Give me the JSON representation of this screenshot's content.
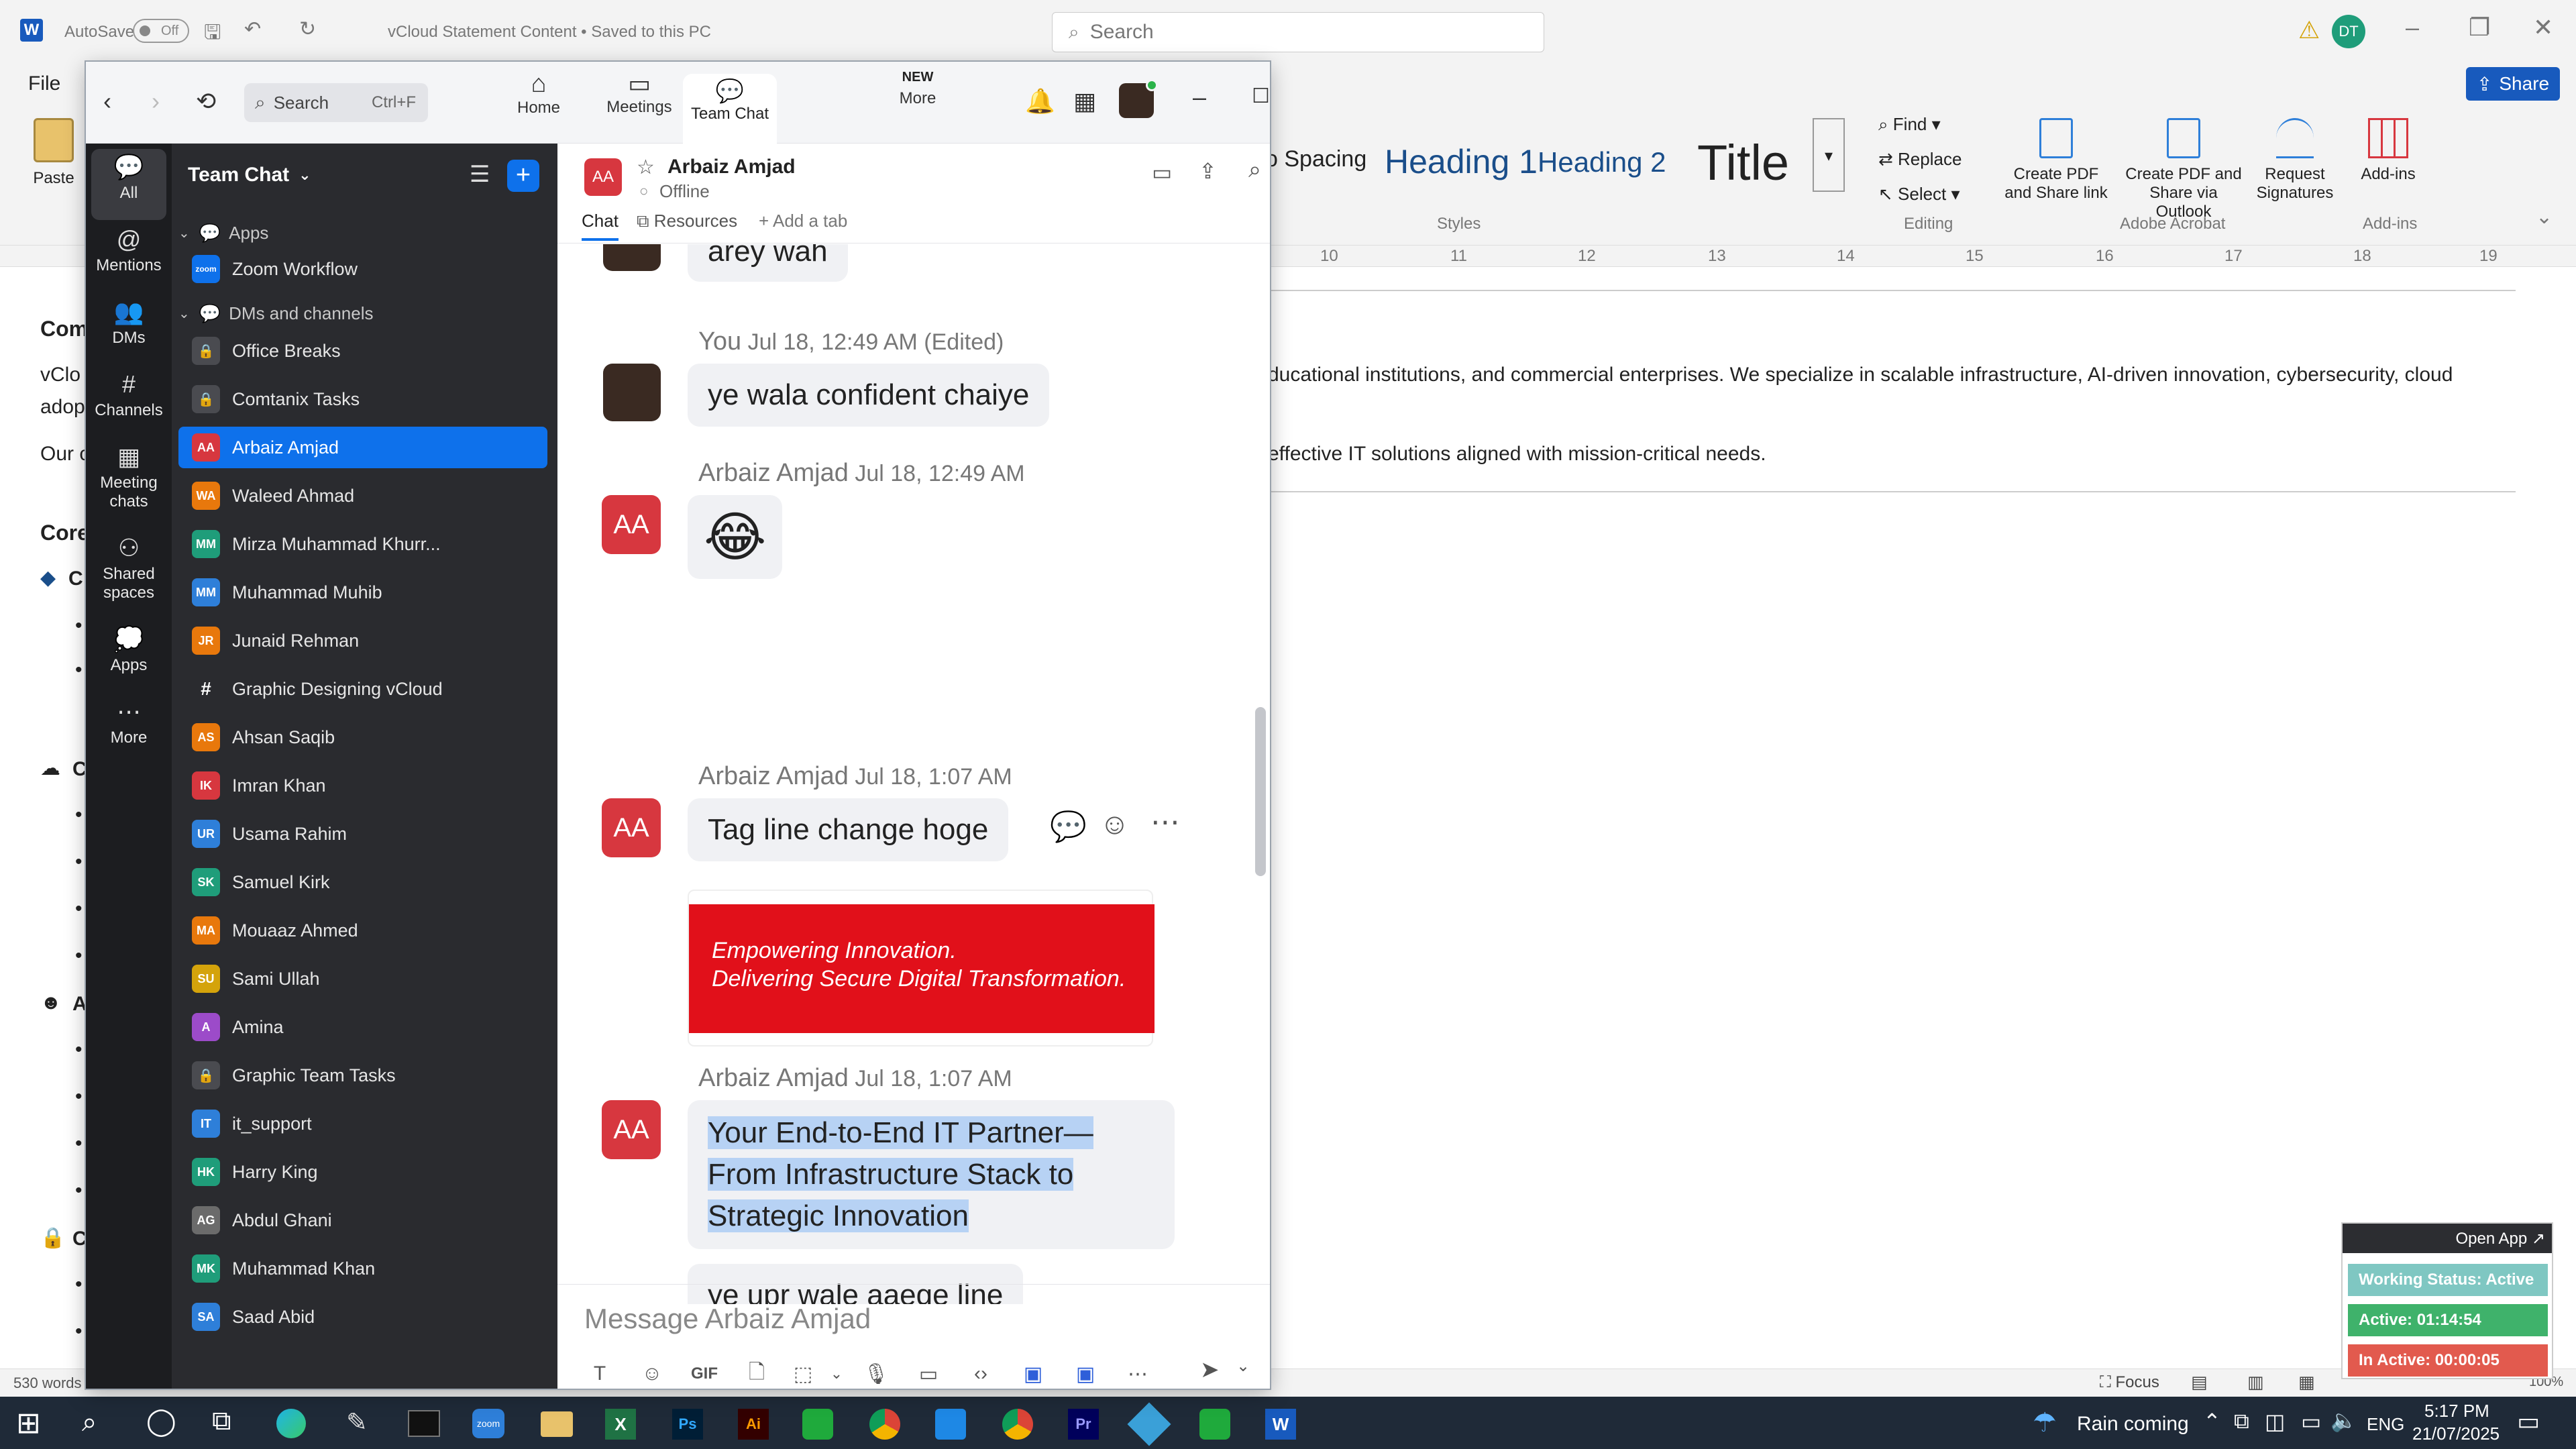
{
  "word": {
    "autosave_label": "AutoSave",
    "autosave_state": "Off",
    "doc_title": "vCloud Statement Content • Saved to this PC",
    "search_placeholder": "Search",
    "user_initials": "DT",
    "file_tab": "File",
    "share_label": "Share",
    "paste_label": "Paste",
    "styles": {
      "no_spacing": "o Spacing",
      "heading1": "Heading 1",
      "heading2": "Heading 2",
      "title": "Title",
      "group": "Styles"
    },
    "editing": {
      "find": "Find",
      "replace": "Replace",
      "select": "Select",
      "group": "Editing"
    },
    "acrobat": {
      "create_pdf_share": "Create PDF and Share link",
      "create_pdf_outlook": "Create PDF and Share via Outlook",
      "request_signatures": "Request Signatures",
      "group": "Adobe Acrobat"
    },
    "addins": {
      "label": "Add-ins",
      "group": "Add-ins"
    },
    "ruler_numbers": [
      "10",
      "11",
      "12",
      "13",
      "14",
      "15",
      "16",
      "17",
      "18",
      "19"
    ],
    "doc_lines": {
      "line1_left": "Com",
      "line2_left": "vClo",
      "line2_right": "ducational institutions, and commercial enterprises. We specialize in scalable infrastructure, AI-driven innovation, cybersecurity, cloud",
      "line3_left": "adop",
      "line4_left": "Our c",
      "line4_right": "effective IT solutions aligned with mission-critical needs.",
      "core": "Core",
      "c1": "C",
      "c2": "C",
      "a": "A",
      "c3": "C"
    },
    "status_words": "530 words",
    "focus_label": "Focus",
    "zoom_pct": "100%"
  },
  "zoom": {
    "search_label": "Search",
    "search_shortcut": "Ctrl+F",
    "nav": [
      {
        "label": "Home"
      },
      {
        "label": "Meetings"
      },
      {
        "label": "Team Chat"
      },
      {
        "label": "More",
        "badge": "NEW"
      }
    ],
    "rail": [
      {
        "label": "All"
      },
      {
        "label": "Mentions"
      },
      {
        "label": "DMs"
      },
      {
        "label": "Channels"
      },
      {
        "label": "Meeting chats"
      },
      {
        "label": "Shared spaces"
      },
      {
        "label": "Apps"
      },
      {
        "label": "More"
      }
    ],
    "list_title": "Team Chat",
    "sections": {
      "apps": "Apps",
      "dms": "DMs and channels"
    },
    "apps_item": "Zoom Workflow",
    "contacts": [
      {
        "initials": "",
        "name": "Office Breaks",
        "color": "#4a4b50",
        "kind": "lock"
      },
      {
        "initials": "",
        "name": "Comtanix Tasks",
        "color": "#4a4b50",
        "kind": "lock"
      },
      {
        "initials": "AA",
        "name": "Arbaiz Amjad",
        "color": "#d7373f",
        "kind": "person"
      },
      {
        "initials": "WA",
        "name": "Waleed Ahmad",
        "color": "#e8780c",
        "kind": "person"
      },
      {
        "initials": "MM",
        "name": "Mirza Muhammad Khurr...",
        "color": "#1f9d7a",
        "kind": "person"
      },
      {
        "initials": "MM",
        "name": "Muhammad Muhib",
        "color": "#2e7fd9",
        "kind": "person"
      },
      {
        "initials": "JR",
        "name": "Junaid Rehman",
        "color": "#e8780c",
        "kind": "person"
      },
      {
        "initials": "#",
        "name": "Graphic Designing vCloud",
        "color": "#4a4b50",
        "kind": "channel"
      },
      {
        "initials": "AS",
        "name": "Ahsan Saqib",
        "color": "#e8780c",
        "kind": "person"
      },
      {
        "initials": "IK",
        "name": "Imran Khan",
        "color": "#d7373f",
        "kind": "person"
      },
      {
        "initials": "UR",
        "name": "Usama Rahim",
        "color": "#2e7fd9",
        "kind": "person"
      },
      {
        "initials": "SK",
        "name": "Samuel Kirk",
        "color": "#1f9d7a",
        "kind": "person"
      },
      {
        "initials": "MA",
        "name": "Mouaaz Ahmed",
        "color": "#e8780c",
        "kind": "person"
      },
      {
        "initials": "SU",
        "name": "Sami Ullah",
        "color": "#d4a30b",
        "kind": "person"
      },
      {
        "initials": "A",
        "name": "Amina",
        "color": "#9c4bc9",
        "kind": "person"
      },
      {
        "initials": "",
        "name": "Graphic Team Tasks",
        "color": "#4a4b50",
        "kind": "lock"
      },
      {
        "initials": "IT",
        "name": "it_support",
        "color": "#2e7fd9",
        "kind": "person"
      },
      {
        "initials": "HK",
        "name": "Harry King",
        "color": "#1f9d7a",
        "kind": "person"
      },
      {
        "initials": "AG",
        "name": "Abdul Ghani",
        "color": "#6b6b6b",
        "kind": "person"
      },
      {
        "initials": "MK",
        "name": "Muhammad Khan",
        "color": "#1f9d7a",
        "kind": "person"
      },
      {
        "initials": "SA",
        "name": "Saad Abid",
        "color": "#2e7fd9",
        "kind": "person"
      }
    ],
    "chat": {
      "initials": "AA",
      "name": "Arbaiz Amjad",
      "status": "Offline",
      "tabs": {
        "chat": "Chat",
        "resources": "Resources",
        "add": "Add a tab"
      },
      "messages": {
        "m0": "arey wah",
        "h1": "You",
        "h1_time": "Jul 18, 12:49 AM (Edited)",
        "m1": "ye wala confident chaiye",
        "h2": "Arbaiz Amjad",
        "h2_time": "Jul 18, 12:49 AM",
        "m2": "😂",
        "h3": "Arbaiz Amjad",
        "h3_time": "Jul 18, 1:07 AM",
        "m3": "Tag line change hoge",
        "banner1": "Empowering Innovation.",
        "banner2": "Delivering Secure Digital Transformation.",
        "h4": "Arbaiz Amjad",
        "h4_time": "Jul 18, 1:07 AM",
        "m4a": "Your End-to-End IT Partner—",
        "m4b": "From Infrastructure Stack to",
        "m4c": "Strategic Innovation",
        "m5": "ye upr wale aaege line"
      },
      "composer_placeholder": "Message Arbaiz Amjad",
      "composer_gif": "GIF"
    }
  },
  "widget": {
    "open_app": "Open App ↗",
    "working": "Working Status: Active",
    "active": "Active: 01:14:54",
    "inactive": "In Active: 00:00:05"
  },
  "taskbar": {
    "weather": "Rain coming",
    "lang": "ENG",
    "time": "5:17 PM",
    "date": "21/07/2025"
  }
}
